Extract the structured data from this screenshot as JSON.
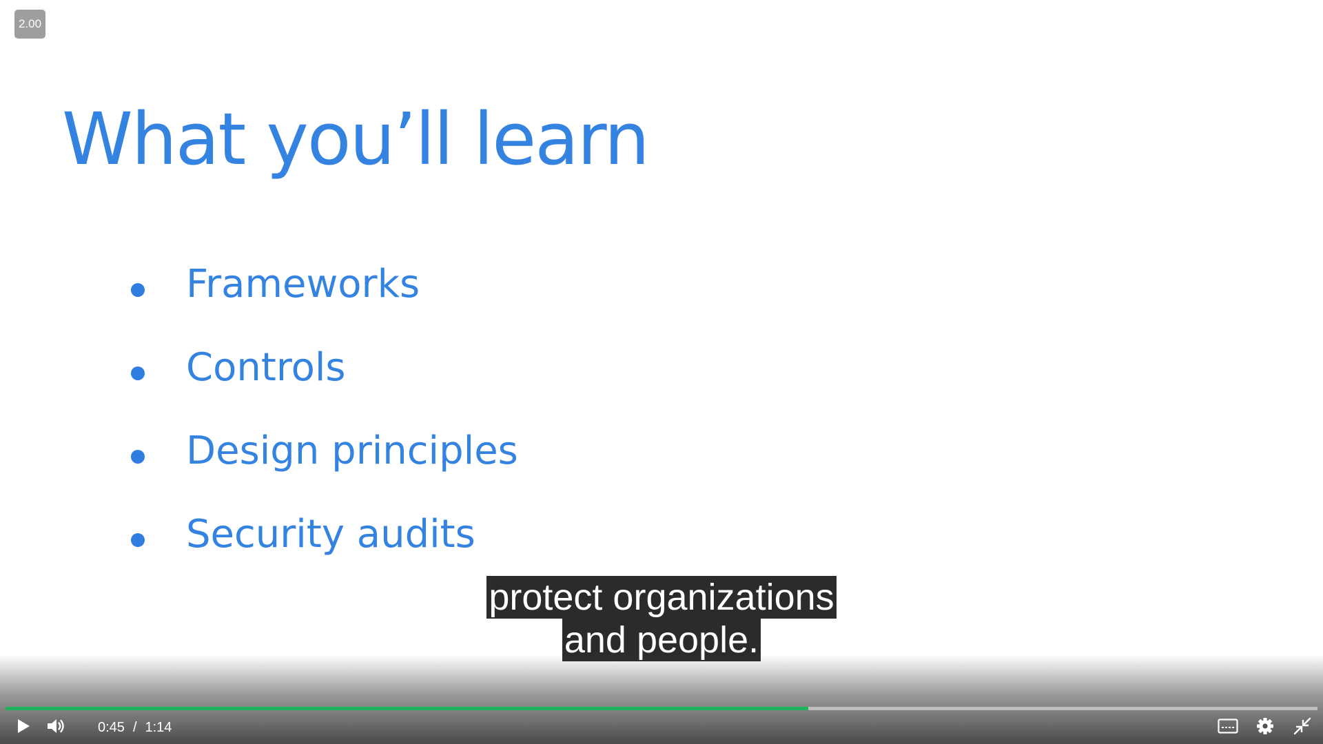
{
  "player": {
    "speed_label": "2.00",
    "slide": {
      "title": "What you’ll learn",
      "bullets": [
        {
          "label": "Frameworks"
        },
        {
          "label": "Controls"
        },
        {
          "label": "Design principles"
        },
        {
          "label": "Security audits"
        }
      ]
    },
    "captions": {
      "lines": [
        "protect organizations",
        "and people."
      ]
    },
    "controls": {
      "current_time": "0:45",
      "separator": "/",
      "duration": "1:14",
      "progress_fraction": 0.612
    },
    "colors": {
      "slide_text": "#3583e1",
      "progress_played": "#1fb35d",
      "speed_badge": "#9e9e9e"
    },
    "icons": {
      "play": "play-icon",
      "volume": "volume-icon",
      "captions": "captions-icon",
      "settings": "gear-icon",
      "exit_fullscreen": "exit-fullscreen-icon"
    }
  }
}
